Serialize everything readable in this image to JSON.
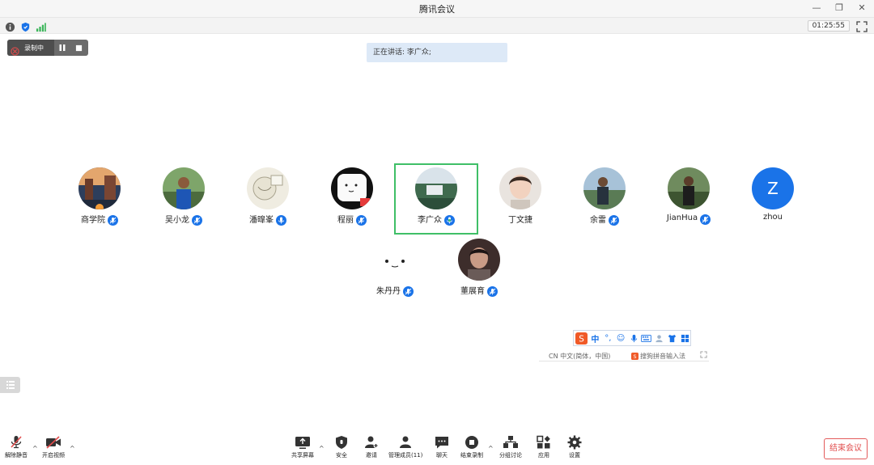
{
  "window": {
    "title": "腾讯会议",
    "timer": "01:25:55"
  },
  "recording": {
    "label": "录制中"
  },
  "speaking": {
    "text": "正在讲话: 李广众;"
  },
  "participants": [
    {
      "name": "商学院",
      "muted": true
    },
    {
      "name": "吴小龙",
      "muted": true
    },
    {
      "name": "潘曍峯",
      "muted": false
    },
    {
      "name": "程丽",
      "muted": true
    },
    {
      "name": "李广众",
      "muted": false,
      "speaking": true
    },
    {
      "name": "丁文捷",
      "muted": null
    },
    {
      "name": "余雷",
      "muted": true
    },
    {
      "name": "JianHua",
      "muted": true
    },
    {
      "name": "zhou",
      "muted": null,
      "initial": "Z"
    },
    {
      "name": "朱丹丹",
      "muted": true
    },
    {
      "name": "董展育",
      "muted": true
    }
  ],
  "ime": {
    "lang": "CN 中文(简体，中国)",
    "engine": "搜狗拼音输入法",
    "zh_label": "中"
  },
  "toolbar": {
    "unmute": "解除静音",
    "video": "开启视频",
    "share": "共享屏幕",
    "security": "安全",
    "invite": "邀请",
    "members": "管理成员(11)",
    "chat": "聊天",
    "stop_record": "结束录制",
    "breakout": "分组讨论",
    "apps": "应用",
    "settings": "设置",
    "end": "结束会议"
  },
  "colors": {
    "accent": "#1a73e8",
    "active_border": "#3fbf67",
    "end": "#e14b4b",
    "speaking_bg": "#dde9f7"
  }
}
